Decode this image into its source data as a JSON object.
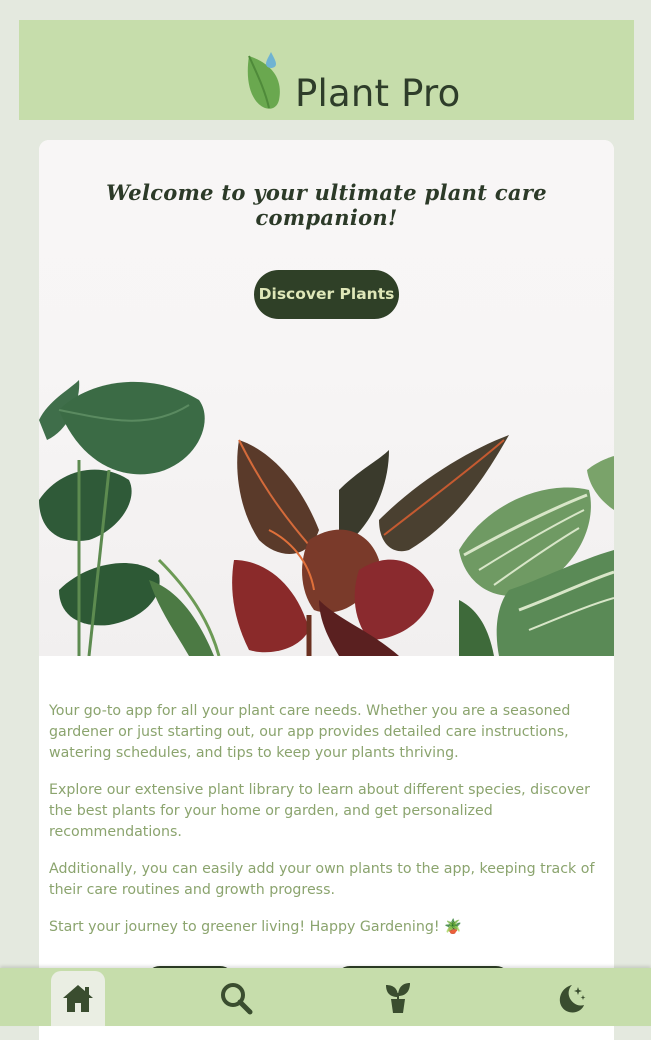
{
  "header": {
    "app_name": "Plant Pro",
    "logo_icon": "leaf-drop-icon"
  },
  "hero": {
    "welcome_text": "Welcome to your ultimate plant care companion!",
    "discover_button_label": "Discover Plants"
  },
  "intro": {
    "paragraphs": [
      "Your go-to app for all your plant care needs. Whether you are a seasoned gardener or just starting out, our app provides detailed care instructions, watering schedules, and tips to keep your plants thriving.",
      "Explore our extensive plant library to learn about different species, discover the best plants for your home or garden, and get personalized recommendations.",
      "Additionally, you can easily add your own plants to the app, keeping track of their care routines and growth progress.",
      "Start your journey to greener living! Happy Gardening! 🪴"
    ]
  },
  "bottom_nav": {
    "items": [
      {
        "name": "home",
        "icon": "home-icon",
        "active": true
      },
      {
        "name": "search",
        "icon": "search-icon",
        "active": false
      },
      {
        "name": "plants",
        "icon": "sprout-icon",
        "active": false
      },
      {
        "name": "theme",
        "icon": "moon-icon",
        "active": false
      }
    ]
  },
  "colors": {
    "header_bg": "#c6ddab",
    "page_bg": "#e4e9df",
    "button_bg": "#2f4027",
    "button_text": "#dfe7b8",
    "body_text": "#8ba46e",
    "title_text": "#2e3d2a"
  }
}
